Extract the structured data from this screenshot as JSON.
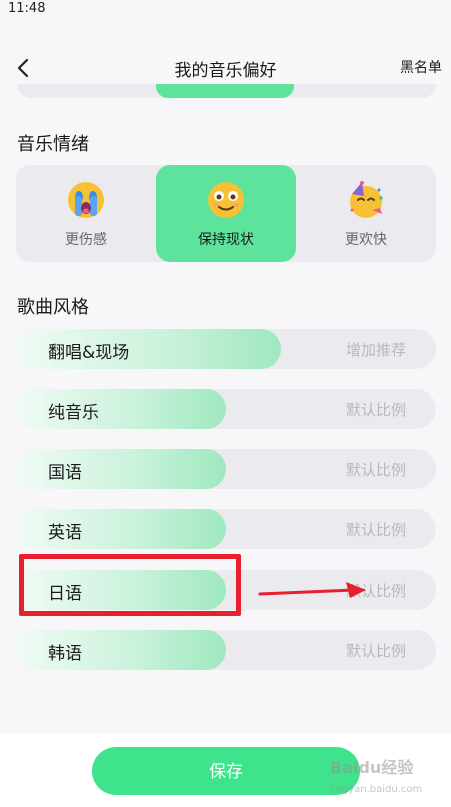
{
  "status_bar": {
    "time": "11:48"
  },
  "nav": {
    "title": "我的音乐偏好",
    "right_action": "黑名单"
  },
  "mood_section": {
    "title": "音乐情绪",
    "options": [
      {
        "label": "更伤感",
        "icon": "crying-face-icon",
        "selected": false
      },
      {
        "label": "保持现状",
        "icon": "smiling-face-icon",
        "selected": true
      },
      {
        "label": "更欢快",
        "icon": "party-face-icon",
        "selected": false
      }
    ]
  },
  "style_section": {
    "title": "歌曲风格",
    "items": [
      {
        "label": "翻唱&现场",
        "value": "增加推荐",
        "level": 0.63
      },
      {
        "label": "纯音乐",
        "value": "默认比例",
        "level": 0.5
      },
      {
        "label": "国语",
        "value": "默认比例",
        "level": 0.5
      },
      {
        "label": "英语",
        "value": "默认比例",
        "level": 0.5
      },
      {
        "label": "日语",
        "value": "默认比例",
        "level": 0.5
      },
      {
        "label": "韩语",
        "value": "默认比例",
        "level": 0.5
      }
    ]
  },
  "annotation": {
    "highlighted_item": "日语",
    "color": "#e8202d"
  },
  "footer": {
    "save_label": "保存"
  },
  "watermark": {
    "text": "Baidu经验",
    "subtext": "jingyan.baidu.com"
  },
  "colors": {
    "accent": "#5ee39d",
    "button": "#3ee38b",
    "track": "#ebebef"
  }
}
